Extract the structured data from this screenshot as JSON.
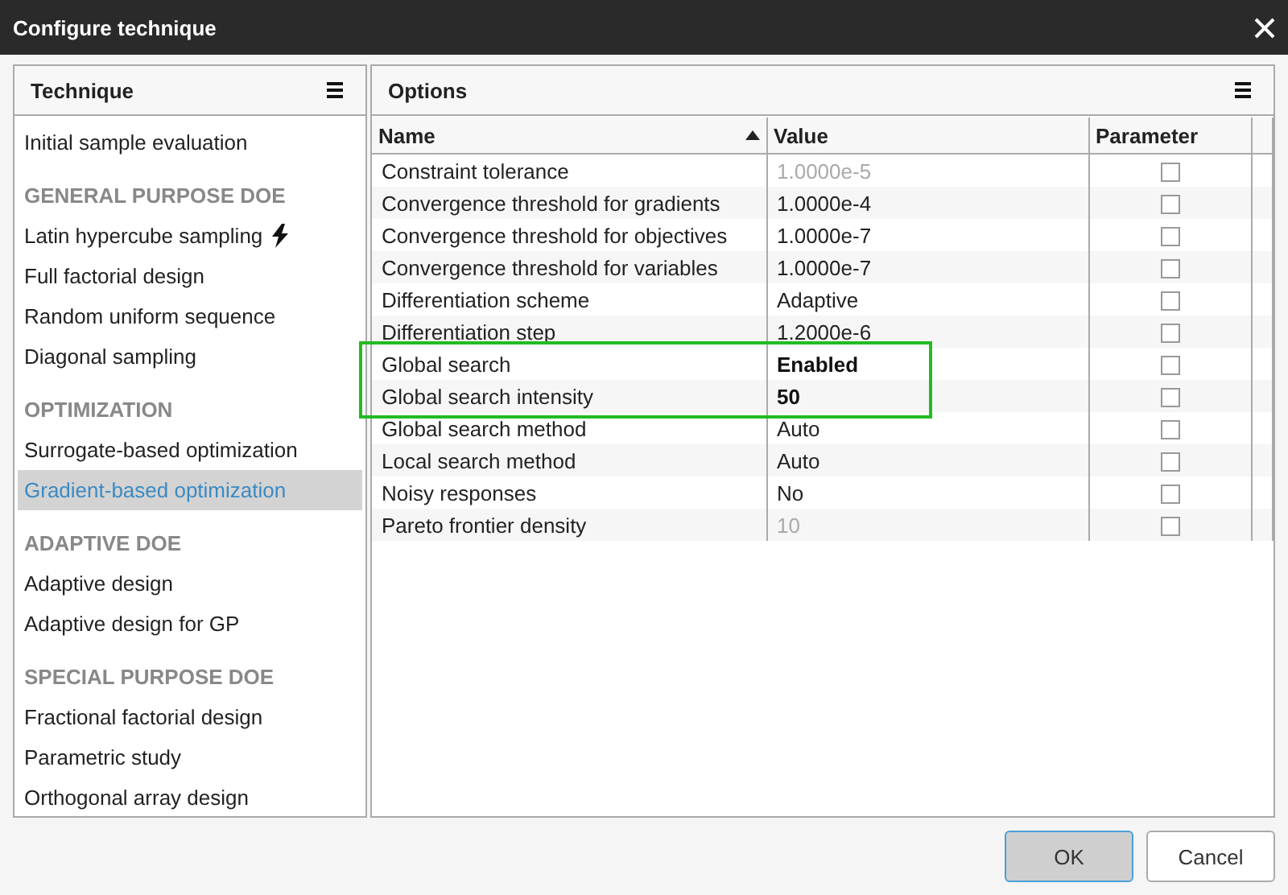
{
  "window": {
    "title": "Configure technique"
  },
  "technique_panel": {
    "title": "Technique",
    "items": [
      {
        "kind": "item",
        "label": "Initial sample evaluation",
        "selected": false
      },
      {
        "kind": "section",
        "label": "GENERAL PURPOSE DOE"
      },
      {
        "kind": "item",
        "label": "Latin hypercube sampling",
        "selected": false,
        "flash": true
      },
      {
        "kind": "item",
        "label": "Full factorial design",
        "selected": false
      },
      {
        "kind": "item",
        "label": "Random uniform sequence",
        "selected": false
      },
      {
        "kind": "item",
        "label": "Diagonal sampling",
        "selected": false
      },
      {
        "kind": "section",
        "label": "OPTIMIZATION"
      },
      {
        "kind": "item",
        "label": "Surrogate-based optimization",
        "selected": false
      },
      {
        "kind": "item",
        "label": "Gradient-based optimization",
        "selected": true
      },
      {
        "kind": "section",
        "label": "ADAPTIVE DOE"
      },
      {
        "kind": "item",
        "label": "Adaptive design",
        "selected": false
      },
      {
        "kind": "item",
        "label": "Adaptive design for GP",
        "selected": false
      },
      {
        "kind": "section",
        "label": "SPECIAL PURPOSE DOE"
      },
      {
        "kind": "item",
        "label": "Fractional factorial design",
        "selected": false
      },
      {
        "kind": "item",
        "label": "Parametric study",
        "selected": false
      },
      {
        "kind": "item",
        "label": "Orthogonal array design",
        "selected": false
      }
    ]
  },
  "options_panel": {
    "title": "Options",
    "table": {
      "columns": [
        "Name",
        "Value",
        "Parameter"
      ],
      "rows": [
        {
          "name": "Constraint tolerance",
          "value": "1.0000e-5",
          "kind": "default",
          "parameter": false,
          "highlighted": false
        },
        {
          "name": "Convergence threshold for gradients",
          "value": "1.0000e-4",
          "kind": "set",
          "parameter": false,
          "highlighted": false
        },
        {
          "name": "Convergence threshold for objectives",
          "value": "1.0000e-7",
          "kind": "set",
          "parameter": false,
          "highlighted": false
        },
        {
          "name": "Convergence threshold for variables",
          "value": "1.0000e-7",
          "kind": "set",
          "parameter": false,
          "highlighted": false
        },
        {
          "name": "Differentiation scheme",
          "value": "Adaptive",
          "kind": "set",
          "parameter": false,
          "highlighted": false
        },
        {
          "name": "Differentiation step",
          "value": "1.2000e-6",
          "kind": "set",
          "parameter": false,
          "highlighted": false
        },
        {
          "name": "Global search",
          "value": "Enabled",
          "kind": "changed",
          "parameter": false,
          "highlighted": true
        },
        {
          "name": "Global search intensity",
          "value": "50",
          "kind": "changed",
          "parameter": false,
          "highlighted": true
        },
        {
          "name": "Global search method",
          "value": "Auto",
          "kind": "set",
          "parameter": false,
          "highlighted": false
        },
        {
          "name": "Local search method",
          "value": "Auto",
          "kind": "set",
          "parameter": false,
          "highlighted": false
        },
        {
          "name": "Noisy responses",
          "value": "No",
          "kind": "set",
          "parameter": false,
          "highlighted": false
        },
        {
          "name": "Pareto frontier density",
          "value": "10",
          "kind": "default",
          "parameter": false,
          "highlighted": false
        }
      ]
    }
  },
  "buttons": [
    {
      "label": "OK",
      "default": true
    },
    {
      "label": "Cancel",
      "default": false
    }
  ]
}
